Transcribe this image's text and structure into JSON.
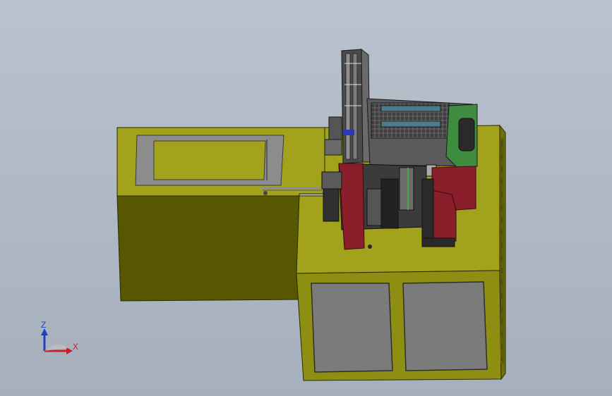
{
  "viewport": {
    "background_top": "#b9c2cd",
    "background_bottom": "#a6b0bd"
  },
  "colors": {
    "base_top": "#a3a21c",
    "base_front": "#565700",
    "base_side": "#6f6f0c",
    "base_right_face": "#8e8e12",
    "panel_gray": "#7b7b7b",
    "panel_dark": "#555555",
    "frame_light": "#b4b4b4",
    "machine_red": "#8a1f2b",
    "machine_dark": "#2b2b2b",
    "pcb_green": "#3f8b3f",
    "axis_x": "#c8202a",
    "axis_z": "#1f3fbf"
  },
  "triad": {
    "z_label": "Z",
    "x_label": "X",
    "icon": "coordinate-triad-icon"
  }
}
